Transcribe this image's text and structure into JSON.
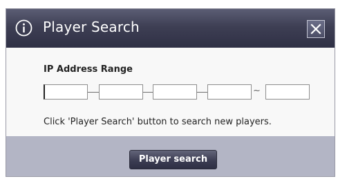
{
  "dialog": {
    "title": "Player Search",
    "close_label": "X",
    "info_icon": "info-circle-icon",
    "close_icon": "close-icon"
  },
  "form": {
    "range_label": "IP Address Range",
    "ip_start": [
      "",
      "",
      "",
      ""
    ],
    "ip_end": "",
    "separator": "~",
    "hint": "Click 'Player Search' button to search new players."
  },
  "footer": {
    "search_button_label": "Player search"
  },
  "colors": {
    "titlebar": "#3e3f54",
    "footer": "#b3b5c5",
    "button": "#3c3d53"
  }
}
